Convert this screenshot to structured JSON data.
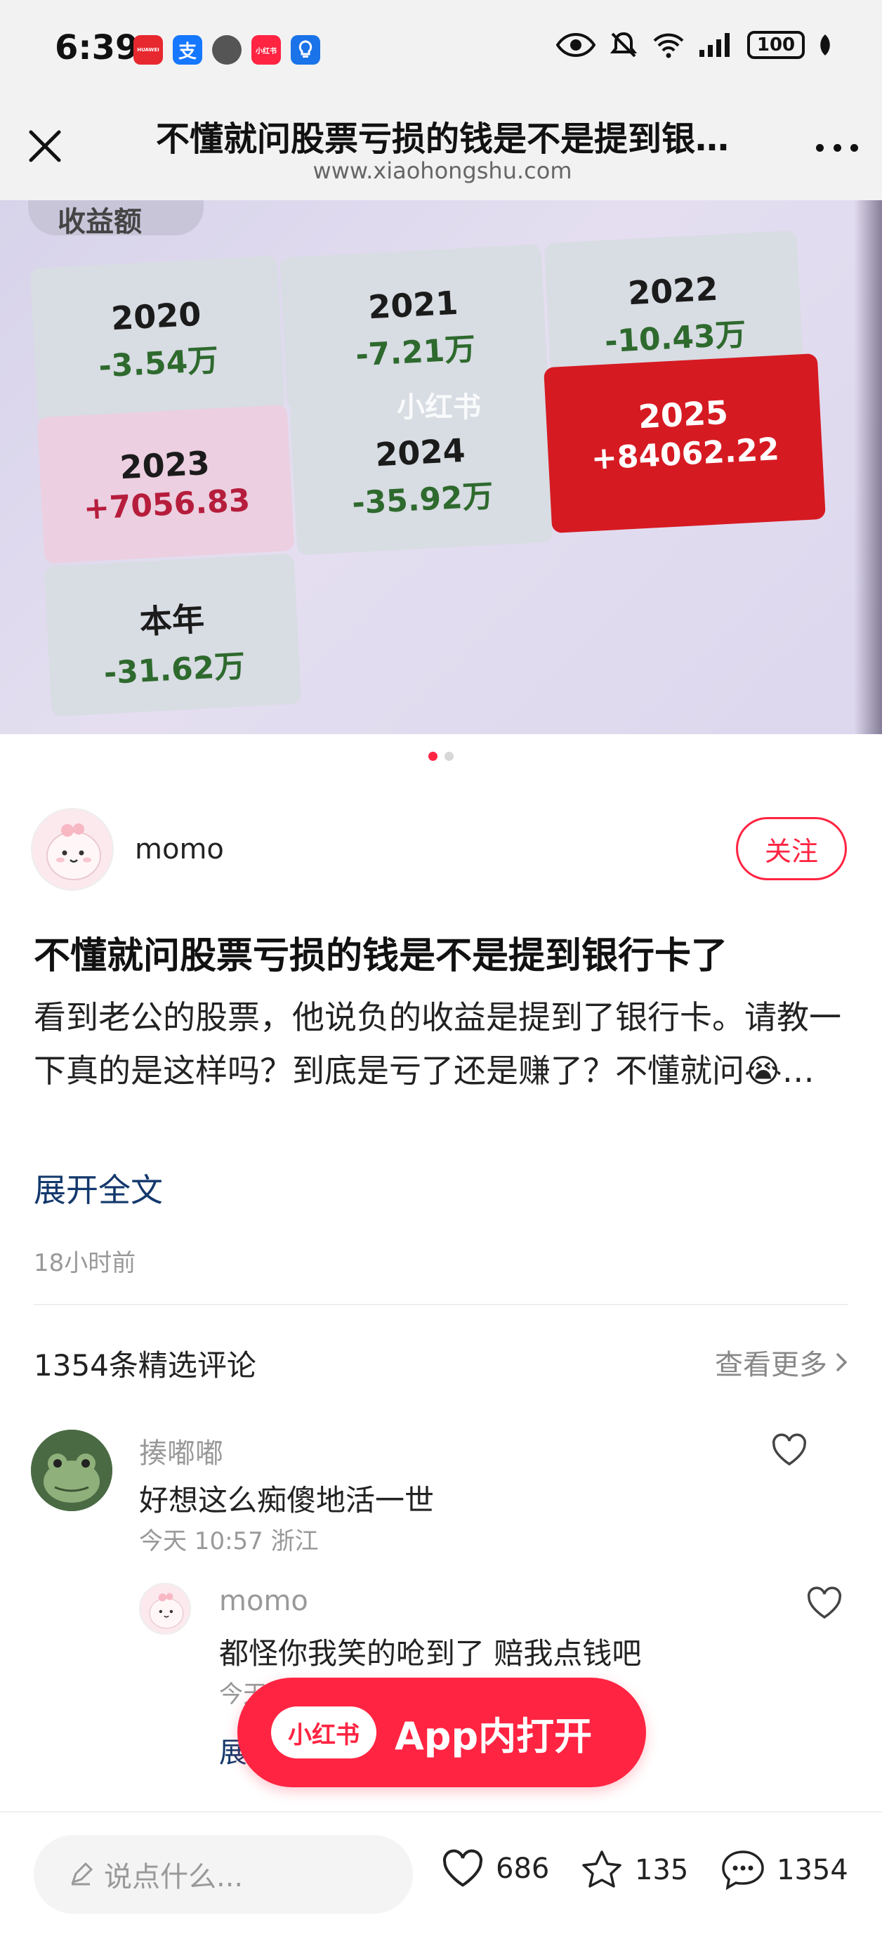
{
  "status_bar": {
    "time": "6:39",
    "battery": "100",
    "app_icons": [
      {
        "name": "huawei-app-icon",
        "label": "HUAWEI",
        "color": "#e8282f"
      },
      {
        "name": "alipay-app-icon",
        "label": "支",
        "color": "#1677ff"
      },
      {
        "name": "game-app-icon",
        "label": "",
        "color": "#555555"
      },
      {
        "name": "xiaohongshu-app-icon",
        "label": "小红书",
        "color": "#ff2442"
      },
      {
        "name": "lightbulb-app-icon",
        "label": "",
        "color": "#1a73e8"
      }
    ]
  },
  "header": {
    "title": "不懂就问股票亏损的钱是不是提到银…",
    "url": "www.xiaohongshu.com"
  },
  "photo": {
    "tab_label": "收益额",
    "watermark": "小红书",
    "cells": [
      {
        "year": "2020",
        "amount": "-3.54万"
      },
      {
        "year": "2021",
        "amount": "-7.21万"
      },
      {
        "year": "2022",
        "amount": "-10.43万"
      },
      {
        "year": "2023",
        "amount": "+7056.83"
      },
      {
        "year": "2024",
        "amount": "-35.92万"
      },
      {
        "year": "2025",
        "amount": "+84062.22"
      },
      {
        "year": "本年",
        "amount": "-31.62万"
      }
    ],
    "page_indicator": {
      "current": 1,
      "total": 2
    }
  },
  "author": {
    "name": "momo",
    "follow_label": "关注"
  },
  "note": {
    "title": "不懂就问股票亏损的钱是不是提到银行卡了",
    "body": "看到老公的股票，他说负的收益是提到了银行卡。请教一下真的是这样吗？到底是亏了还是赚了？不懂就问😭…",
    "expand_label": "展开全文",
    "time": "18小时前"
  },
  "comments": {
    "count_label": "1354条精选评论",
    "more_label": "查看更多",
    "items": [
      {
        "user": "揍嘟嘟",
        "text": "好想这么痴傻地活一世",
        "meta": "今天 10:57 浙江"
      },
      {
        "user": "momo",
        "text": "都怪你我笑的呛到了 赔我点钱吧",
        "meta": "今天",
        "more_replies": "展"
      }
    ]
  },
  "open_app": {
    "logo": "小红书",
    "label": "App内打开"
  },
  "bottom_bar": {
    "input_placeholder": "说点什么...",
    "likes": "686",
    "stars": "135",
    "comments": "1354"
  },
  "colors": {
    "brand_red": "#ff2442",
    "link_blue": "#13386c",
    "loss_green": "#2e6a2e",
    "gain_red": "#d61a22"
  }
}
